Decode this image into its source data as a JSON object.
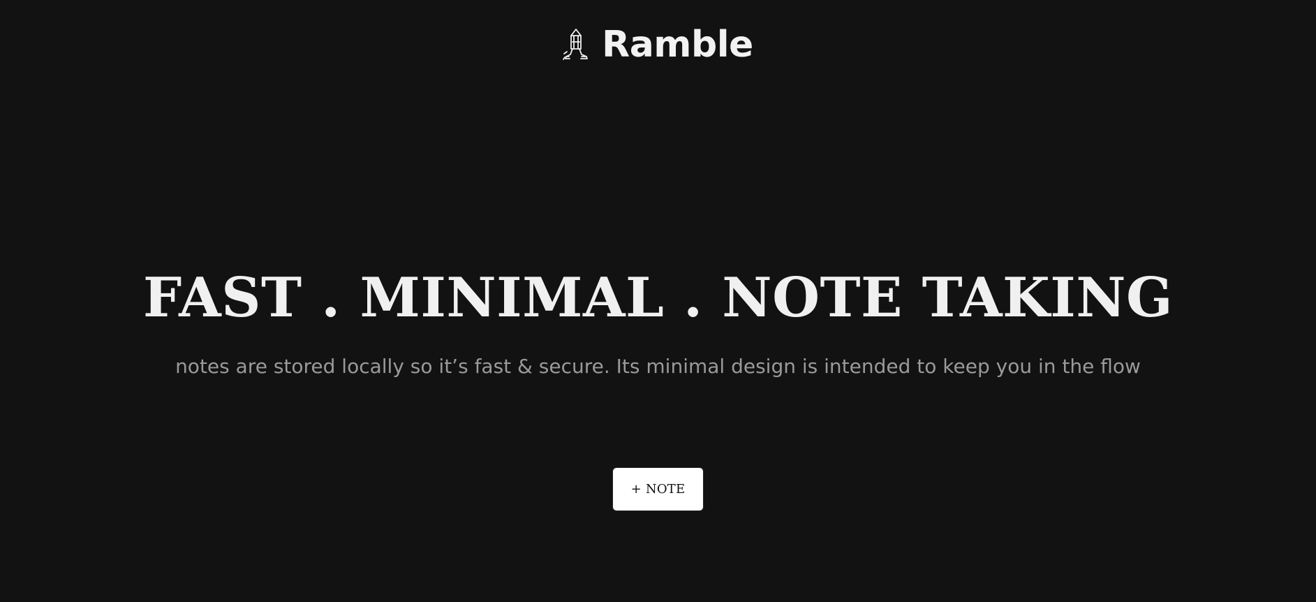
{
  "app": {
    "name": "Ramble",
    "logo_icon": "pencil-walker-icon"
  },
  "hero": {
    "title": "FAST . MINIMAL . NOTE TAKING",
    "subtitle": "notes are stored locally so it’s fast & secure. Its minimal design is intended to keep you in the flow"
  },
  "actions": {
    "new_note_label": "+ NOTE"
  },
  "colors": {
    "background": "#121212",
    "title": "#f0f0f0",
    "subtitle": "#9a9a9a",
    "button_bg": "#ffffff",
    "button_text": "#121212"
  }
}
